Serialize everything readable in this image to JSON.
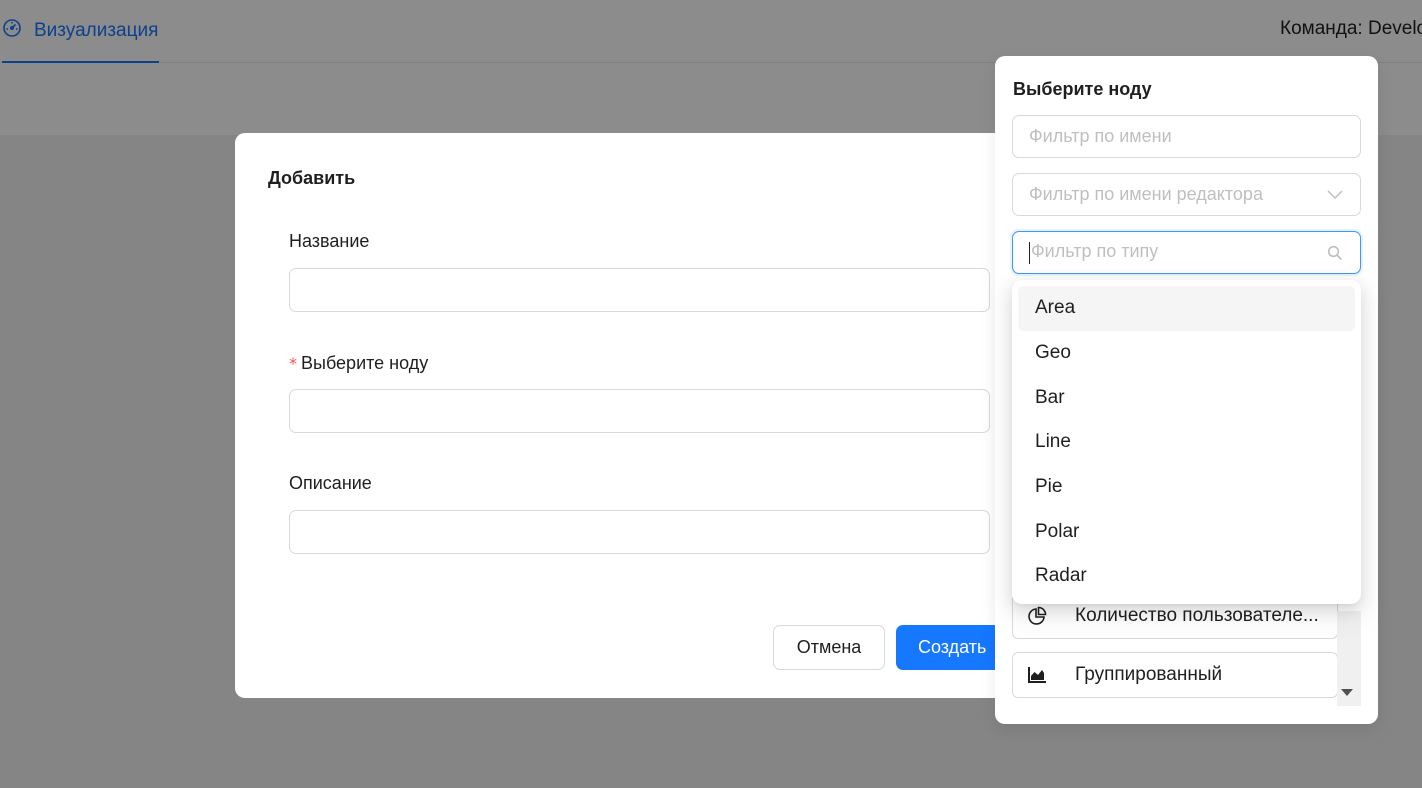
{
  "header": {
    "tab_label": "Визуализация",
    "team_label": "Команда: Develo"
  },
  "modal": {
    "title": "Добавить",
    "fields": [
      {
        "label": "Название",
        "required": false,
        "value": ""
      },
      {
        "label": "Выберите ноду",
        "required": true,
        "value": ""
      },
      {
        "label": "Описание",
        "required": false,
        "value": ""
      }
    ],
    "required_mark": "*",
    "cancel_label": "Отмена",
    "create_label": "Создать"
  },
  "node_picker": {
    "title": "Выберите ноду",
    "filter_name_placeholder": "Фильтр по имени",
    "filter_editor_placeholder": "Фильтр по имени редактора",
    "filter_type_placeholder": "Фильтр по типу",
    "filter_type_value": "",
    "type_options": [
      "Area",
      "Geo",
      "Bar",
      "Line",
      "Pie",
      "Polar",
      "Radar"
    ],
    "active_option": "Area",
    "nodes": [
      {
        "label": "Количество пользователе...",
        "icon": "pie-chart-icon"
      },
      {
        "label": "Группированный",
        "icon": "area-chart-icon"
      }
    ]
  },
  "colors": {
    "primary": "#1677ff",
    "required": "#ff4d4f",
    "mask": "rgba(0,0,0,0.45)"
  }
}
